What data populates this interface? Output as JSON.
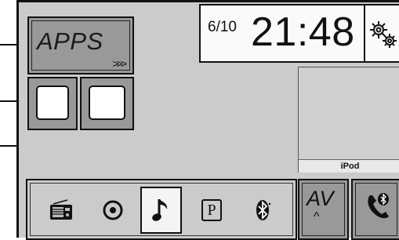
{
  "apps": {
    "label": "APPS",
    "chevron": ">>>"
  },
  "clock": {
    "date": "6/10",
    "time": "21:48"
  },
  "media_preview": {
    "source_label": "iPod"
  },
  "av": {
    "label": "AV",
    "caret": "^"
  },
  "source_bar": {
    "items": [
      {
        "icon": "radio-icon"
      },
      {
        "icon": "disc-icon"
      },
      {
        "icon": "music-note-icon",
        "selected": true
      },
      {
        "icon": "parking-icon",
        "glyph": "P"
      },
      {
        "icon": "bluetooth-icon"
      }
    ]
  },
  "phone": {
    "icon": "phone-icon"
  },
  "settings": {
    "icon": "gear-icon"
  },
  "colors": {
    "background": "#cbcbcb",
    "tile_active": "#999999",
    "white": "#ffffff",
    "border": "#111111"
  }
}
